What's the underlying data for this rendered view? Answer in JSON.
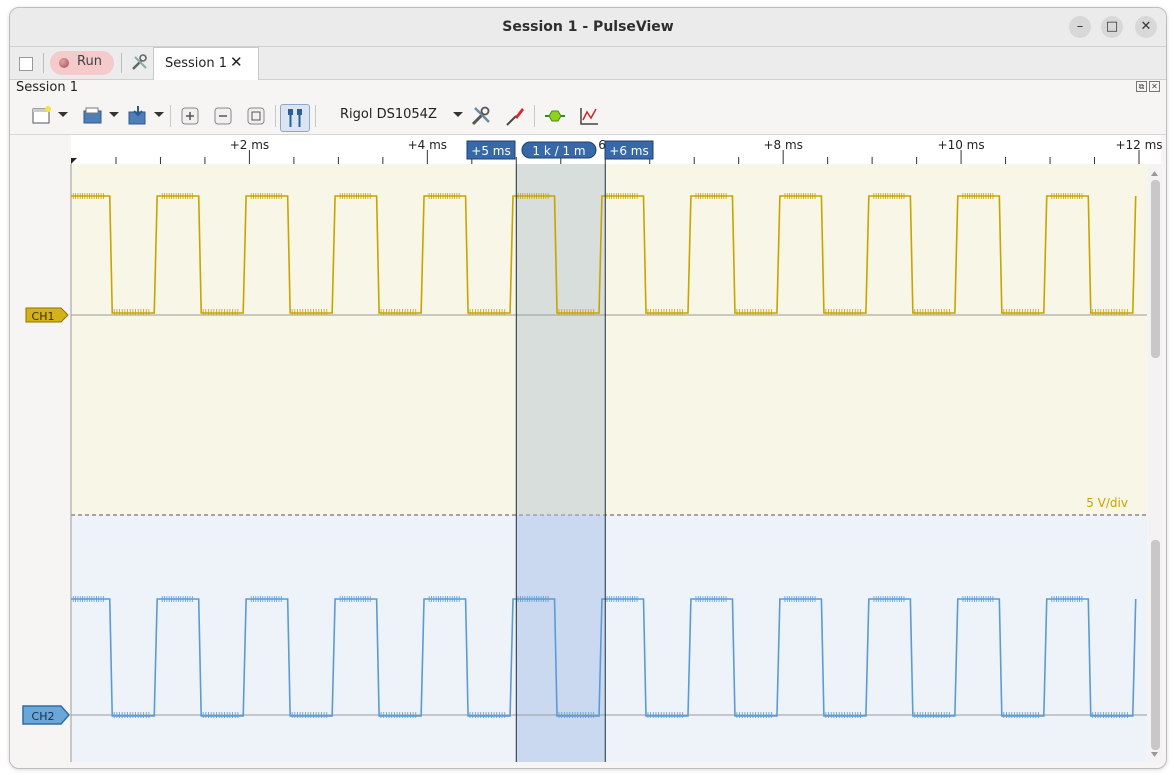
{
  "window": {
    "title": "Session 1 - PulseView",
    "minimize_icon": "minimize-icon",
    "maximize_icon": "maximize-icon",
    "close_icon": "close-icon"
  },
  "tabbar": {
    "run_label": "Run",
    "tab_label": "Session 1"
  },
  "session": {
    "label": "Session 1"
  },
  "toolbar": {
    "device": "Rigol DS1054Z"
  },
  "ruler": {
    "ticks": [
      "+2 ms",
      "+4 ms",
      "+8 ms",
      "+10 ms",
      "+12 ms"
    ],
    "cursor_left": "+5 ms",
    "cursor_mid": "1 k / 1 m",
    "cursor_right": "+6 ms",
    "hidden_fragment": "6"
  },
  "channels": [
    {
      "name": "CH1",
      "color": "#c8a400",
      "bg": "#f8f6e6",
      "scale": "5 V/div"
    },
    {
      "name": "CH2",
      "color": "#5b9bd5",
      "bg": "#eef3f9"
    }
  ],
  "chart_data": {
    "type": "line",
    "x_unit": "ms",
    "x_range": [
      0,
      12
    ],
    "cursor_range_ms": [
      5,
      6
    ],
    "series": [
      {
        "name": "CH1",
        "period_ms": 1,
        "duty": 0.5,
        "high": 1,
        "low": 0
      },
      {
        "name": "CH2",
        "period_ms": 1,
        "duty": 0.5,
        "high": 1,
        "low": 0
      }
    ]
  }
}
